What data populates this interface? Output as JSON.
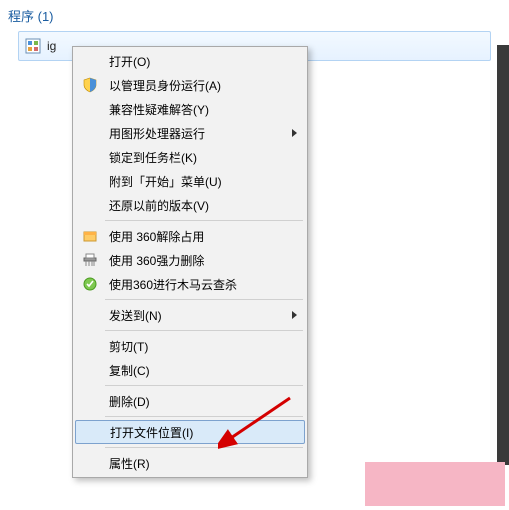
{
  "header": {
    "title": "程序 (1)"
  },
  "result": {
    "filename_visible": "ig"
  },
  "menu": {
    "items": [
      {
        "label": "打开(O)",
        "icon": "none",
        "submenu": false
      },
      {
        "label": "以管理员身份运行(A)",
        "icon": "shield",
        "submenu": false
      },
      {
        "label": "兼容性疑难解答(Y)",
        "icon": "none",
        "submenu": false
      },
      {
        "label": "用图形处理器运行",
        "icon": "none",
        "submenu": true
      },
      {
        "label": "锁定到任务栏(K)",
        "icon": "none",
        "submenu": false
      },
      {
        "label": "附到「开始」菜单(U)",
        "icon": "none",
        "submenu": false
      },
      {
        "label": "还原以前的版本(V)",
        "icon": "none",
        "submenu": false
      }
    ],
    "group2": [
      {
        "label": "使用 360解除占用",
        "icon": "box-orange"
      },
      {
        "label": "使用 360强力删除",
        "icon": "shredder"
      },
      {
        "label": "使用360进行木马云查杀",
        "icon": "cloud-green"
      }
    ],
    "sendto": {
      "label": "发送到(N)"
    },
    "edit": [
      {
        "label": "剪切(T)"
      },
      {
        "label": "复制(C)"
      }
    ],
    "delete": {
      "label": "删除(D)"
    },
    "openloc": {
      "label": "打开文件位置(I)"
    },
    "props": {
      "label": "属性(R)"
    }
  }
}
